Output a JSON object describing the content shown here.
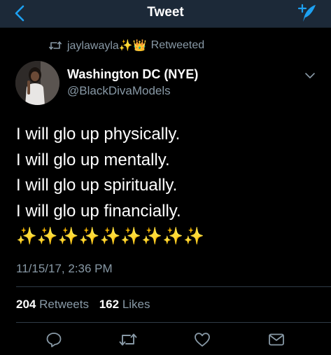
{
  "navbar": {
    "title": "Tweet",
    "back_icon": "chevron-left-icon",
    "compose_icon": "compose-tweet-icon",
    "accent_color": "#1da1f2"
  },
  "retweet_context": {
    "user": "jaylawayla✨👑",
    "label": "Retweeted"
  },
  "author": {
    "display_name": "Washington DC (NYE)",
    "handle": "@BlackDivaModels"
  },
  "tweet": {
    "lines": [
      "I will glo up physically.",
      "I will glo up mentally.",
      "I will glo up spiritually.",
      "I will glo up financially.",
      "✨✨✨✨✨✨✨✨✨"
    ],
    "timestamp": "11/15/17, 2:36 PM"
  },
  "stats": {
    "retweets_count": "204",
    "retweets_label": "Retweets",
    "likes_count": "162",
    "likes_label": "Likes"
  },
  "actions": [
    "reply-icon",
    "retweet-icon",
    "like-icon",
    "direct-message-icon"
  ],
  "colors": {
    "background": "#000000",
    "navbar": "#1c2938",
    "secondary_text": "#8899a6",
    "divider": "#2f3b47"
  }
}
